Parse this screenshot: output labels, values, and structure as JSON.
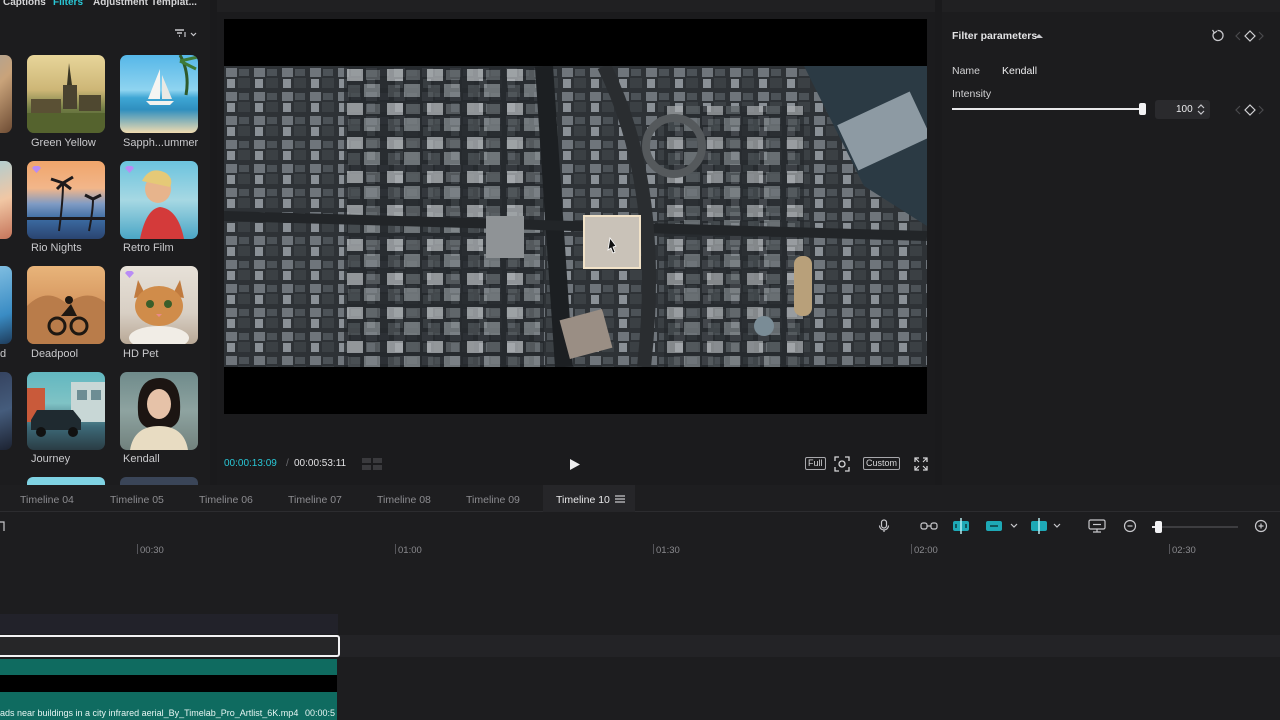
{
  "categories": {
    "captions": "Captions",
    "filters": "Filters",
    "adjustment": "Adjustment",
    "templates": "Templat..."
  },
  "filters": {
    "row1": [
      "Green Yellow",
      "Sapph...ummer"
    ],
    "row2": [
      "Rio Nights",
      "Retro Film"
    ],
    "row3": [
      "Deadpool",
      "HD Pet"
    ],
    "row4": [
      "Journey",
      "Kendall"
    ],
    "left_partial_row3": "d"
  },
  "player": {
    "current_time": "00:00:13:09",
    "separator": "/",
    "total_time": "00:00:53:11",
    "full_label": "Full",
    "custom_label": "Custom"
  },
  "params": {
    "title": "Filter parameters",
    "name_label": "Name",
    "name_value": "Kendall",
    "intensity_label": "Intensity",
    "intensity_value": "100",
    "intensity_fraction": 1.0
  },
  "timeline": {
    "tabs": [
      "Timeline 04",
      "Timeline 05",
      "Timeline 06",
      "Timeline 07",
      "Timeline 08",
      "Timeline 09",
      "Timeline 10"
    ],
    "active_tab": "Timeline 10",
    "ticks": [
      "00:30",
      "01:00",
      "01:30",
      "02:00",
      "02:30"
    ],
    "clip_label": "ads near buildings in a city infrared aerial_By_Timelab_Pro_Artlist_6K.mp4",
    "clip_duration": "00:00:5"
  },
  "colors": {
    "accent": "#29c7d6",
    "clip_teal": "#0f6b60",
    "background": "#1a1a1c"
  }
}
